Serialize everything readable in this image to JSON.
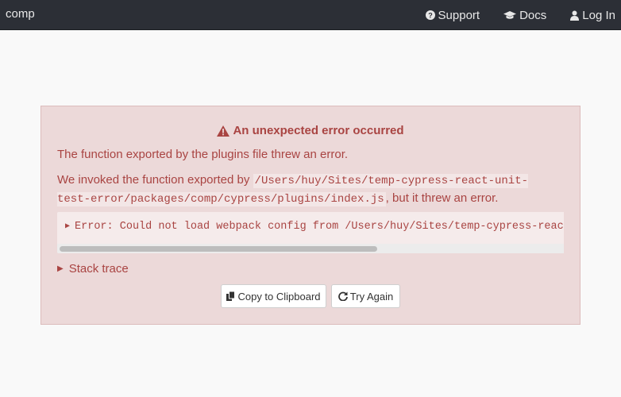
{
  "header": {
    "app_title": "comp",
    "nav": [
      {
        "label": "Support",
        "icon": "question-circle-icon"
      },
      {
        "label": "Docs",
        "icon": "graduation-cap-icon"
      },
      {
        "label": "Log In",
        "icon": "user-icon"
      }
    ]
  },
  "error": {
    "title": "An unexpected error occurred",
    "message1": "The function exported by the plugins file threw an error.",
    "message2_prefix": "We invoked the function exported by ",
    "message2_path": "/Users/huy/Sites/temp-cypress-react-unit-test-error/packages/comp/cypress/plugins/index.js",
    "message2_suffix": ", but it threw an error.",
    "code_text": "Error: Could not load webpack config from /Users/huy/Sites/temp-cypress-react-unit-test-error/packages/comp/webpack.config.js",
    "stack_trace_label": "Stack trace",
    "copy_button": "Copy to Clipboard",
    "retry_button": "Try Again",
    "accent_color": "#a94442"
  }
}
